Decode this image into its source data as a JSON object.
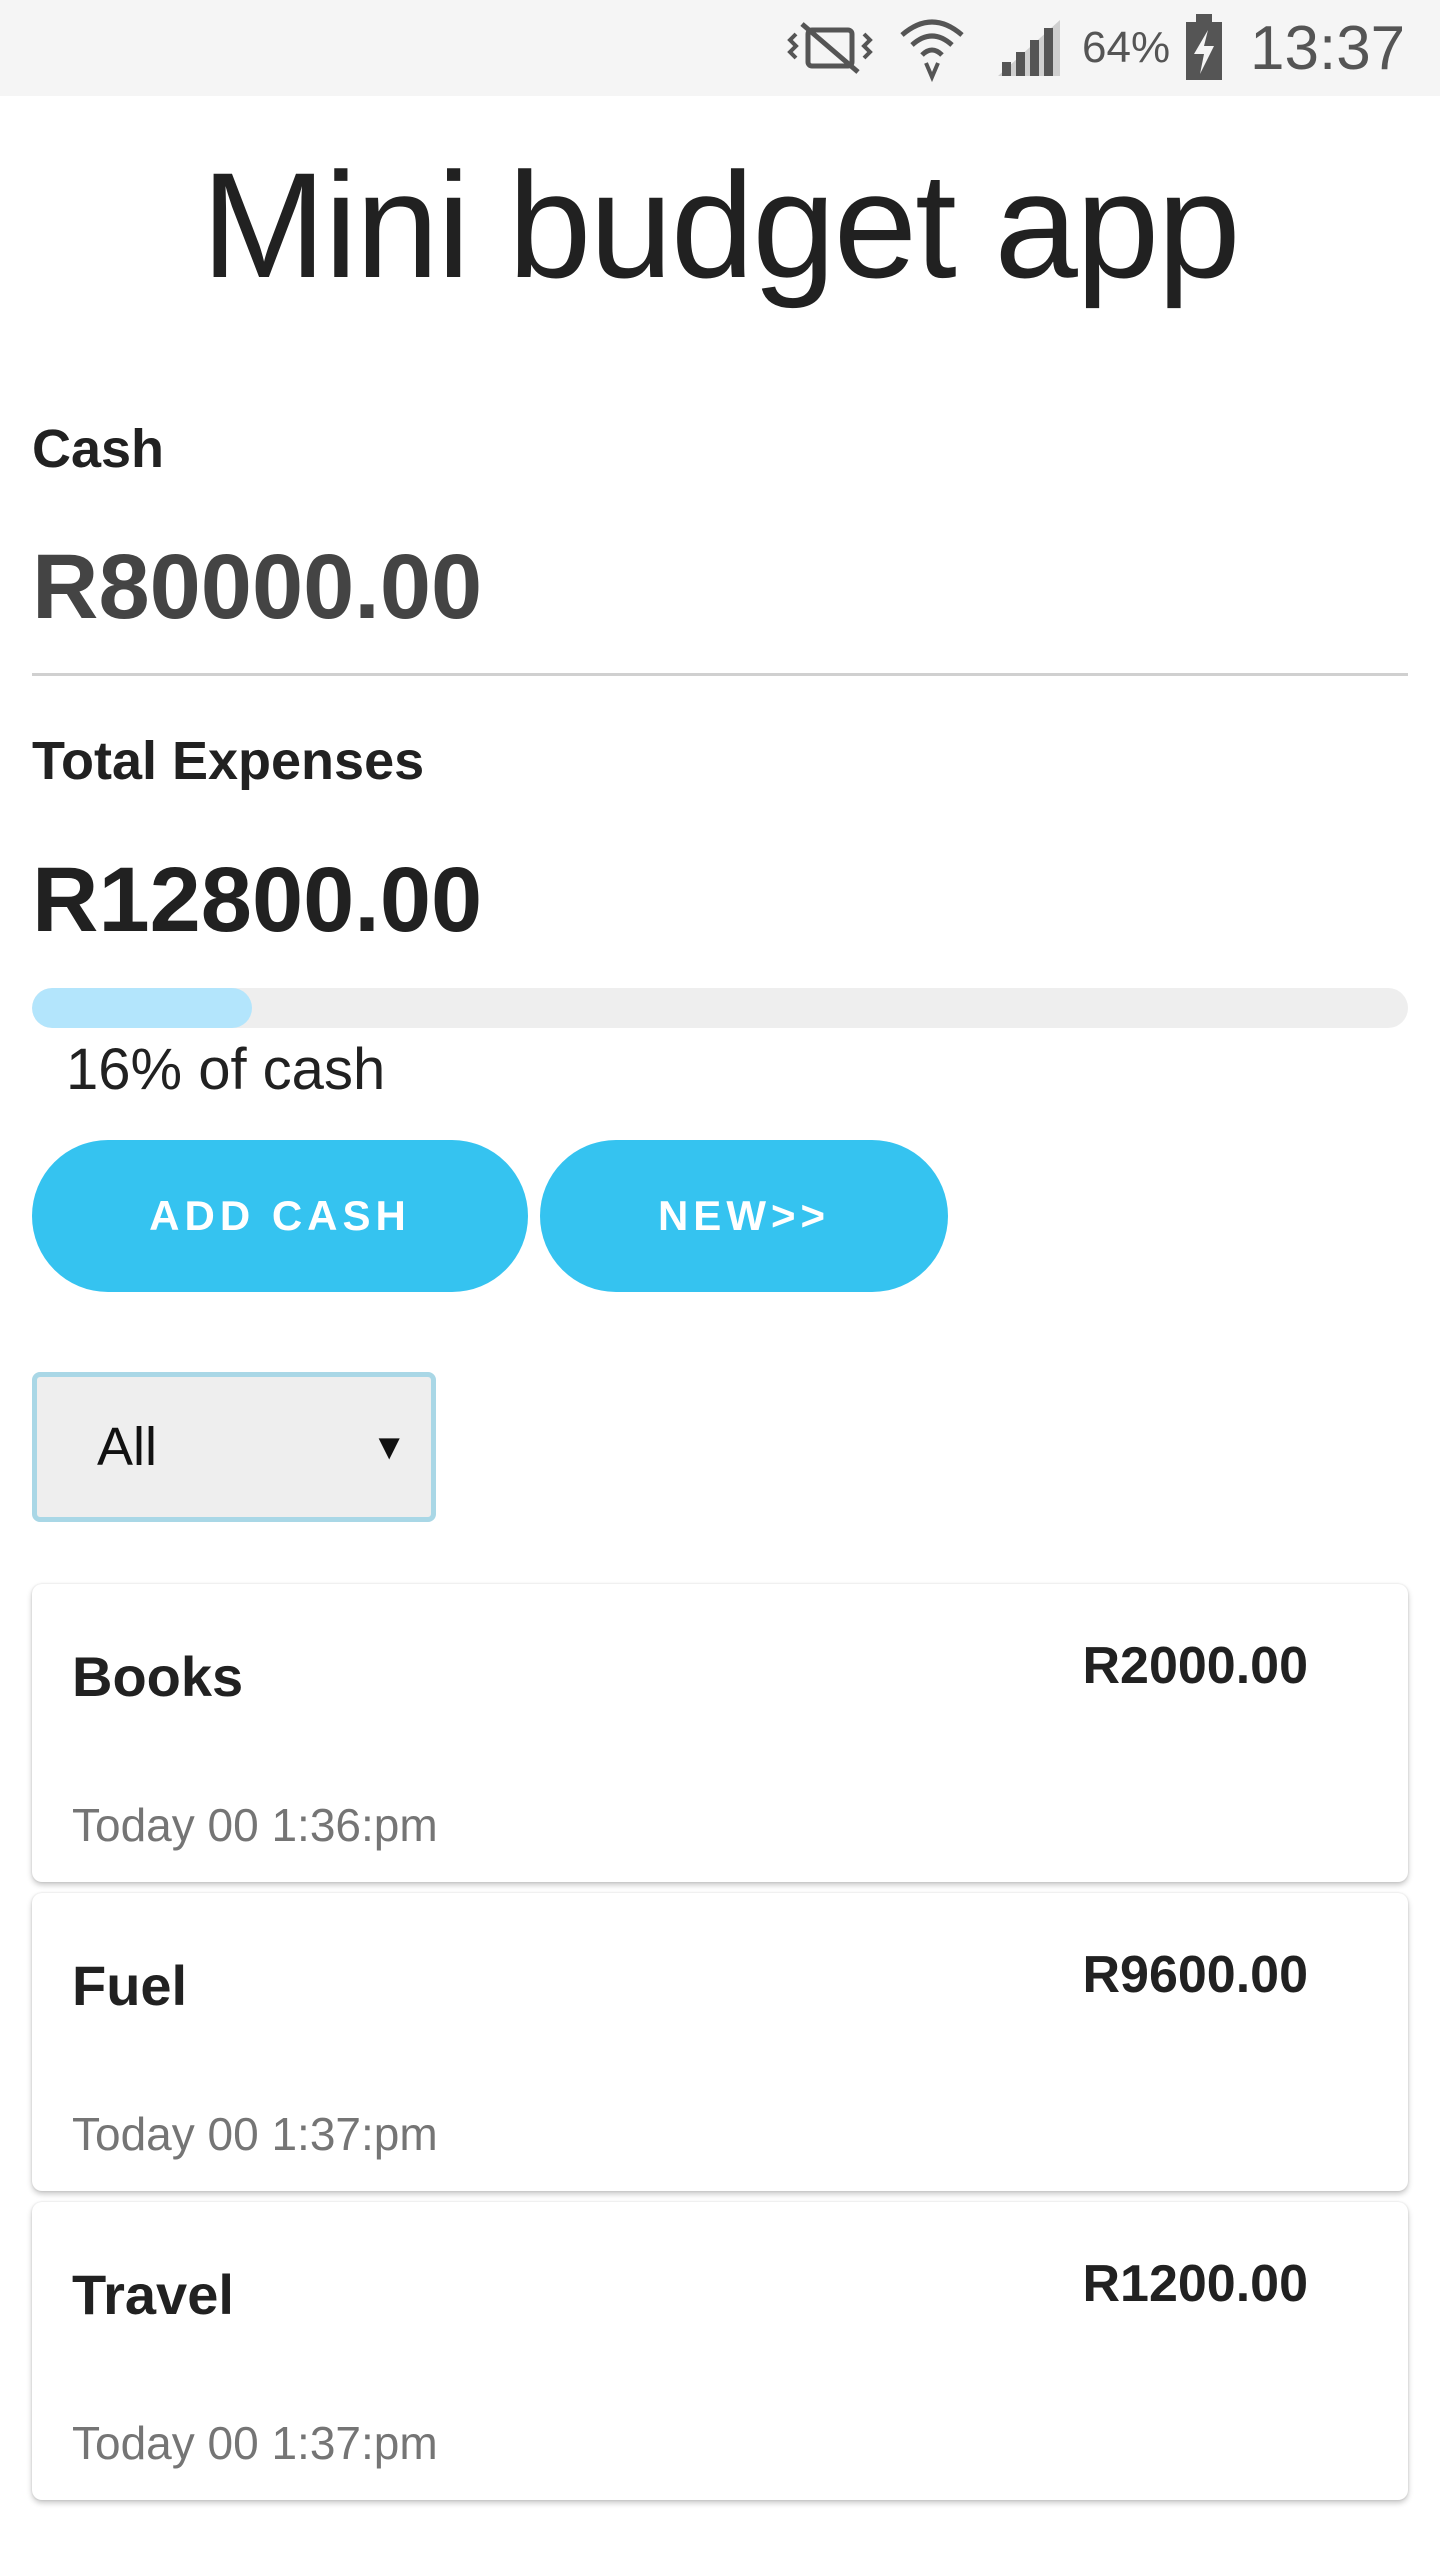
{
  "status_bar": {
    "icons": [
      "vibrate-mute-icon",
      "wifi-icon",
      "signal-icon",
      "battery-charging-icon"
    ],
    "battery_percent": "64%",
    "time": "13:37"
  },
  "app": {
    "title": "Mini budget app"
  },
  "cash": {
    "label": "Cash",
    "amount": "R80000.00"
  },
  "expenses": {
    "label": "Total Expenses",
    "amount": "R12800.00",
    "progress_fraction": 0.16,
    "progress_text": "16% of cash"
  },
  "actions": {
    "add_cash_label": "ADD CASH",
    "new_label": "NEW>>"
  },
  "filter": {
    "selected": "All"
  },
  "expense_items": [
    {
      "name": "Books",
      "amount": "R2000.00",
      "time": "Today 00 1:36:pm"
    },
    {
      "name": "Fuel",
      "amount": "R9600.00",
      "time": "Today 00 1:37:pm"
    },
    {
      "name": "Travel",
      "amount": "R1200.00",
      "time": "Today 00 1:37:pm"
    }
  ],
  "colors": {
    "accent": "#35c3f0",
    "progress_fill": "#b3e5fc",
    "progress_track": "#eeeeee",
    "select_border": "#a9d7e6"
  }
}
